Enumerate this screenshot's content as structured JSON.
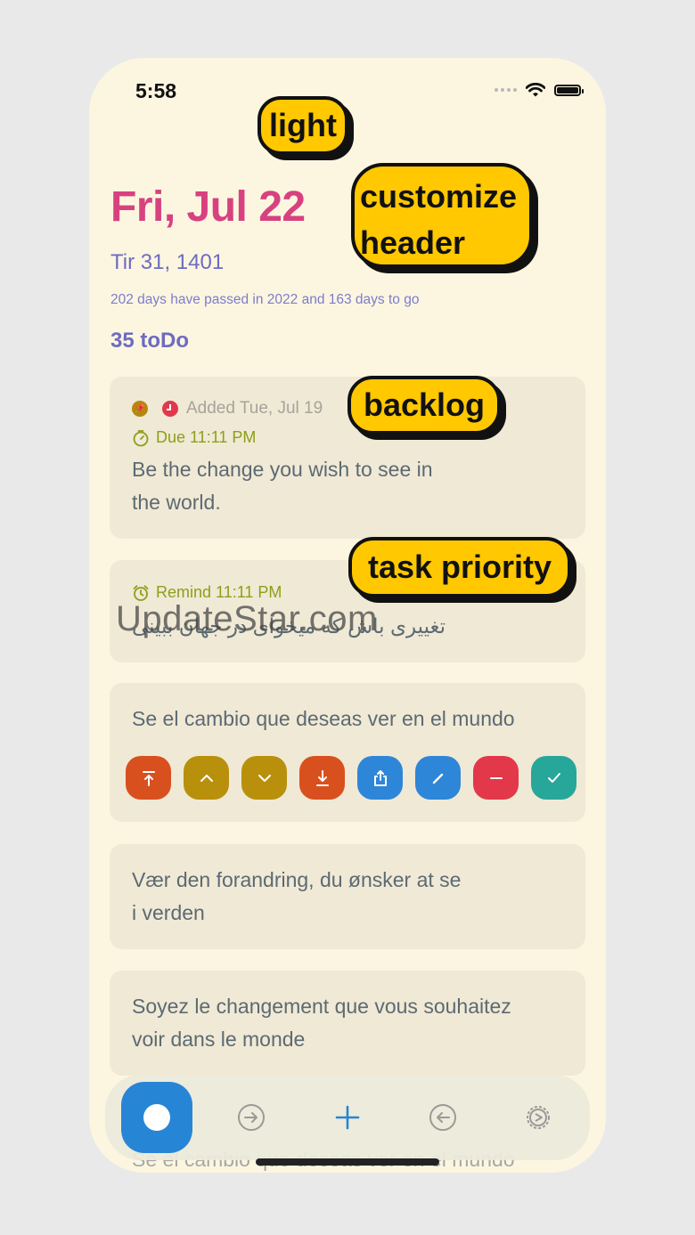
{
  "status": {
    "time": "5:58"
  },
  "header": {
    "date": "Fri, Jul 22",
    "alt_date": "Tir 31, 1401",
    "year_progress": "202 days have passed in 2022 and 163 days to go",
    "todo_count": "35 toDo"
  },
  "tasks": [
    {
      "added": "Added Tue, Jul 19",
      "due": "Due 11:11 PM",
      "text": "Be the change you wish to see in the world.",
      "lines": [
        "Be the change you wish to see in",
        "the world."
      ]
    },
    {
      "remind": "Remind 11:11 PM",
      "text": "تغییری باش که میخوای در جهان ببینی"
    },
    {
      "text": "Se el cambio que deseas ver en el mundo"
    },
    {
      "text": "Vær den forandring, du ønsker at se i verden",
      "lines": [
        "Vær den forandring, du ønsker at se",
        "i verden"
      ]
    },
    {
      "text": "Soyez le changement que vous souhaitez voir dans le monde",
      "lines": [
        "Soyez le changement que vous souhaitez",
        "voir dans le monde"
      ]
    }
  ],
  "behind_text": "Se el cambio que deseas ver en el mundo",
  "actions": [
    {
      "icon": "move-to-top-icon",
      "color": "#d9501f"
    },
    {
      "icon": "chevron-up-icon",
      "color": "#b8900c"
    },
    {
      "icon": "chevron-down-icon",
      "color": "#b8900c"
    },
    {
      "icon": "move-to-bottom-icon",
      "color": "#d9501f"
    },
    {
      "icon": "share-icon",
      "color": "#2e86d8"
    },
    {
      "icon": "edit-icon",
      "color": "#2e86d8"
    },
    {
      "icon": "delete-icon",
      "color": "#e2384a"
    },
    {
      "icon": "check-icon",
      "color": "#27a79a"
    }
  ],
  "tabbar": [
    "record-icon",
    "forward-circle-icon",
    "plus-icon",
    "back-circle-icon",
    "settings-icon"
  ],
  "promo_tags": {
    "light": "light",
    "customize_1": "customize",
    "customize_2": "header",
    "backlog": "backlog",
    "priority": "task priority"
  },
  "watermark": "UpdateStar.com",
  "colors": {
    "background": "#fcf6e1",
    "card": "#f0e9d5",
    "accent": "#d8417f",
    "secondary": "#6d6cbf"
  }
}
